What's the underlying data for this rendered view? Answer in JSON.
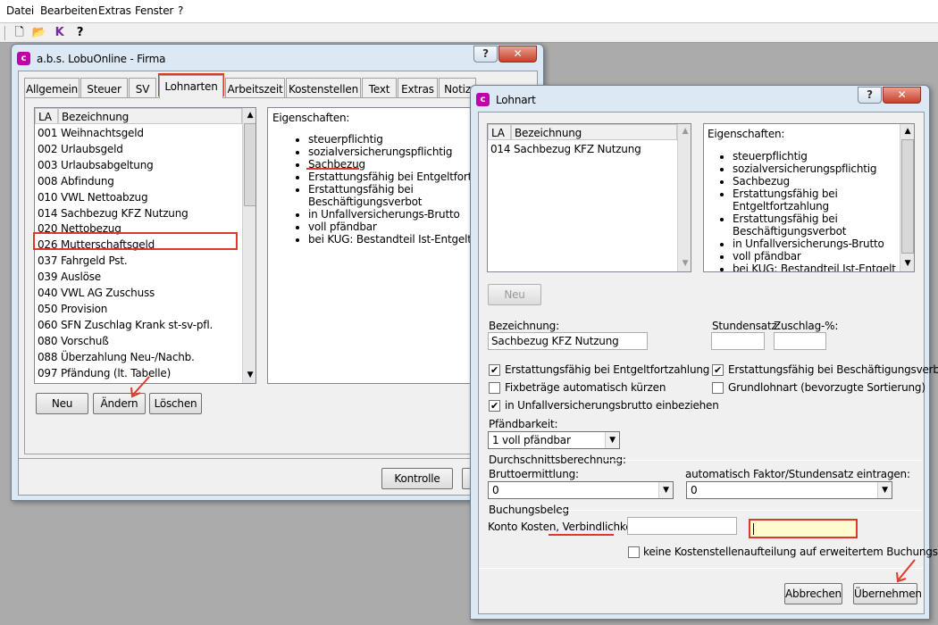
{
  "menu": {
    "items": [
      "Datei",
      "Bearbeiten",
      "Extras",
      "Fenster",
      "?"
    ]
  },
  "toolbar": {
    "icons": [
      "new-document-icon",
      "open-folder-icon",
      "check-k-icon",
      "help-pointer-icon"
    ],
    "glyphs": [
      "🗋",
      "📂",
      "K",
      "?"
    ]
  },
  "win1": {
    "title": "a.b.s. LobuOnline - Firma",
    "help": "?",
    "close": "✕",
    "tabs": [
      "Allgemein",
      "Steuer",
      "SV",
      "Lohnarten",
      "Arbeitszeit",
      "Kostenstellen",
      "Text",
      "Extras",
      "Notiz"
    ],
    "list": {
      "col1": "LA",
      "col2": "Bezeichnung",
      "rows": [
        {
          "la": "001",
          "name": "Weihnachtsgeld"
        },
        {
          "la": "002",
          "name": "Urlaubsgeld"
        },
        {
          "la": "003",
          "name": "Urlaubsabgeltung"
        },
        {
          "la": "008",
          "name": "Abfindung"
        },
        {
          "la": "010",
          "name": "VWL Nettoabzug"
        },
        {
          "la": "014",
          "name": "Sachbezug KFZ Nutzung"
        },
        {
          "la": "020",
          "name": "Nettobezug"
        },
        {
          "la": "026",
          "name": "Mutterschaftsgeld"
        },
        {
          "la": "037",
          "name": "Fahrgeld Pst."
        },
        {
          "la": "039",
          "name": "Auslöse"
        },
        {
          "la": "040",
          "name": "VWL AG Zuschuss"
        },
        {
          "la": "050",
          "name": "Provision"
        },
        {
          "la": "060",
          "name": "SFN Zuschlag Krank st-sv-pfl."
        },
        {
          "la": "080",
          "name": "Vorschuß"
        },
        {
          "la": "088",
          "name": "Überzahlung Neu-/Nachb."
        },
        {
          "la": "097",
          "name": "Pfändung (lt. Tabelle)"
        }
      ]
    },
    "props_label": "Eigenschaften:",
    "props": [
      "steuerpflichtig",
      "sozialversicherungspflichtig",
      "Sachbezug",
      "Erstattungsfähig bei Entgeltfortzahlung",
      "Erstattungsfähig bei Beschäftigungsverbot",
      "in Unfallversicherungs-Brutto",
      "voll pfändbar",
      "bei KUG: Bestandteil Ist-Entgelt"
    ],
    "props_lines": [
      "steuerpflichtig",
      "sozialversicherungspflichtig",
      "Sachbezug",
      "Erstattungsfähig bei Entgeltfortzahlung",
      "Erstattungsfähig bei|Beschäftigungsverbot",
      "in Unfallversicherungs-Brutto",
      "voll pfändbar",
      "bei KUG: Bestandteil Ist-Entgelt"
    ],
    "btn_neu": "Neu",
    "btn_aendern": "Ändern",
    "btn_loeschen": "Löschen",
    "btn_kontrolle": "Kontrolle"
  },
  "win2": {
    "title": "Lohnart",
    "help": "?",
    "close": "✕",
    "list": {
      "col1": "LA",
      "col2": "Bezeichnung",
      "rows": [
        {
          "la": "014",
          "name": "Sachbezug KFZ Nutzung"
        }
      ]
    },
    "props_label": "Eigenschaften:",
    "props": [
      "steuerpflichtig",
      "sozialversicherungspflichtig",
      "Sachbezug",
      "Erstattungsfähig bei Entgeltfortzahlung",
      "Erstattungsfähig bei Beschäftigungsverbot",
      "in Unfallversicherungs-Brutto",
      "voll pfändbar",
      "bei KUG: Bestandteil Ist-Entgelt"
    ],
    "btn_neu": "Neu",
    "bez_label": "Bezeichnung:",
    "bez_value": "Sachbezug KFZ Nutzung",
    "stundensatz_label": "Stundensatz:",
    "zuschlag_label": "Zuschlag-%:",
    "chk_entgelt": "Erstattungsfähig bei Entgeltfortzahlung",
    "chk_besch": "Erstattungsfähig bei Beschäftigungsverbot",
    "chk_fix": "Fixbeträge automatisch kürzen",
    "chk_grund": "Grundlohnart (bevorzugte Sortierung)",
    "chk_unfall": "in Unfallversicherungsbrutto einbeziehen",
    "pfaend_label": "Pfändbarkeit:",
    "pfaend_value": "1 voll pfändbar",
    "durch_label": "Durchschnittsberechnung:",
    "brutto_label": "Bruttoermittlung:",
    "brutto_value": "0",
    "faktor_label": "automatisch Faktor/Stundensatz eintragen:",
    "faktor_value": "0",
    "buchung_label": "Buchungsbeleg",
    "konto_label_a": "Konto Kosten, ",
    "konto_label_b": "Verbindlichkeit:",
    "kst_label": "keine Kostenstellenaufteilung auf erweitertem Buchungsbeleg",
    "btn_abbrechen": "Abbrechen",
    "btn_uebernehmen": "Übernehmen"
  },
  "colors": {
    "accent_red": "#e0392b",
    "highlight_field": "#fffbd0"
  }
}
